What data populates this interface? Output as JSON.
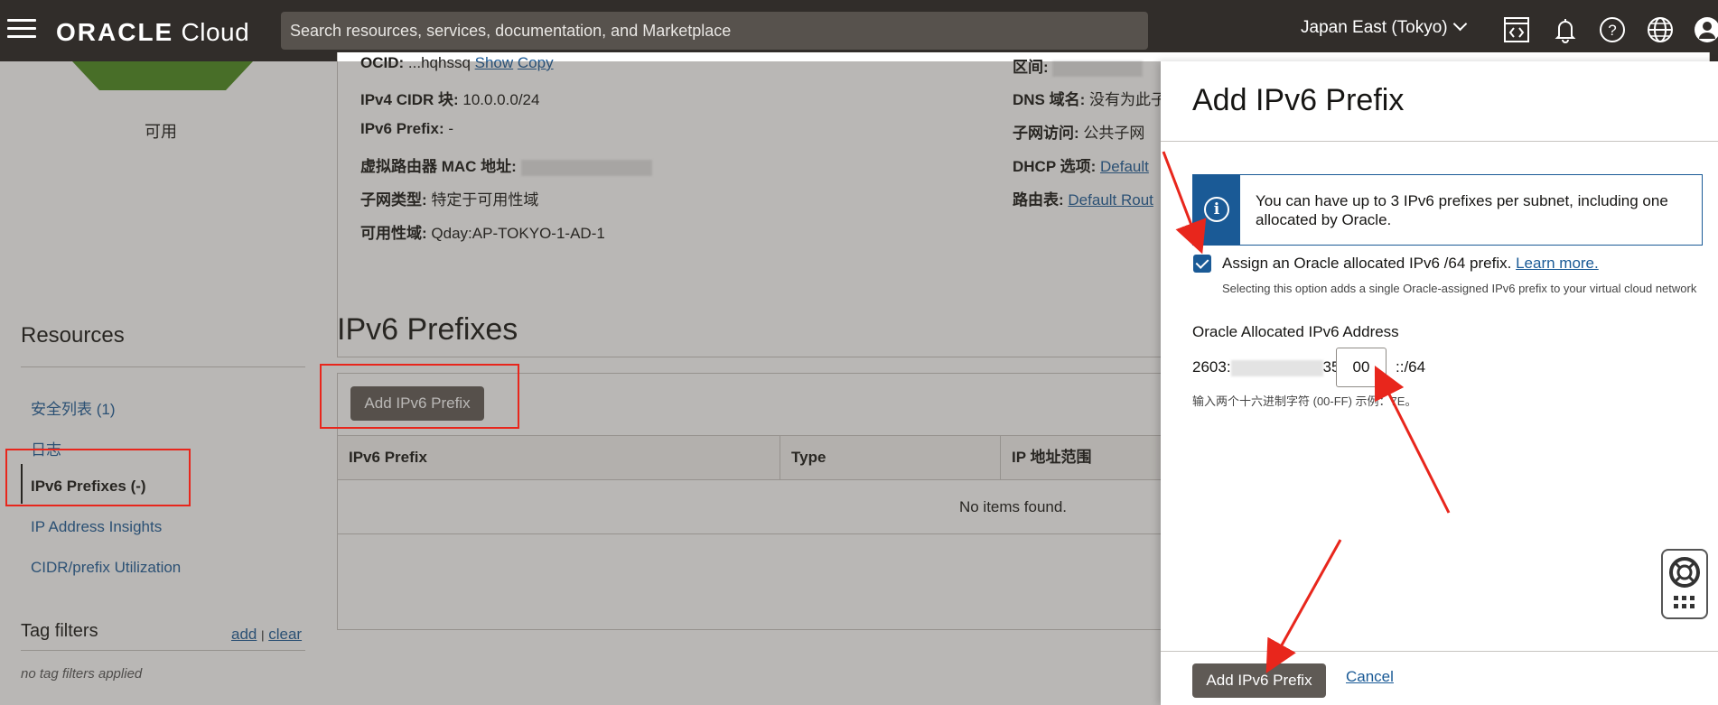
{
  "topbar": {
    "logo_oracle": "ORACLE",
    "logo_cloud": "Cloud",
    "search_placeholder": "Search resources, services, documentation, and Marketplace",
    "region": "Japan East (Tokyo)",
    "icons": [
      "code-editor-icon",
      "bell-icon",
      "help-icon",
      "globe-icon",
      "user-icon"
    ]
  },
  "subnet": {
    "status": "可用",
    "details_left": [
      {
        "label": "OCID:",
        "value": "...hqhssq",
        "links": [
          "Show",
          "Copy"
        ]
      },
      {
        "label": "IPv4 CIDR 块:",
        "value": "10.0.0.0/24"
      },
      {
        "label": "IPv6 Prefix:",
        "value": "-"
      },
      {
        "label": "虚拟路由器 MAC 地址:",
        "value": ""
      },
      {
        "label": "子网类型:",
        "value": "特定于可用性域"
      },
      {
        "label": "可用性域:",
        "value": "Qday:AP-TOKYO-1-AD-1"
      }
    ],
    "details_right": [
      {
        "label": "区间:",
        "value": ""
      },
      {
        "label": "DNS 域名:",
        "value": "没有为此子"
      },
      {
        "label": "子网访问:",
        "value": "公共子网"
      },
      {
        "label": "DHCP 选项:",
        "value": "Default"
      },
      {
        "label": "路由表:",
        "value": "Default Rout"
      }
    ]
  },
  "resources": {
    "title": "Resources",
    "items": [
      {
        "label": "安全列表 (1)"
      },
      {
        "label": "日志"
      },
      {
        "label": "IPv6 Prefixes (-)",
        "active": true
      },
      {
        "label": "IP Address Insights"
      },
      {
        "label": "CIDR/prefix Utilization"
      }
    ]
  },
  "tag_filters": {
    "title": "Tag filters",
    "add": "add",
    "separator": "|",
    "clear": "clear",
    "empty": "no tag filters applied"
  },
  "prefix_section": {
    "title": "IPv6 Prefixes",
    "add_button": "Add IPv6 Prefix",
    "columns": [
      "IPv6 Prefix",
      "Type",
      "IP 地址范围"
    ],
    "empty": "No items found."
  },
  "panel": {
    "title": "Add IPv6 Prefix",
    "info_icon": "i",
    "info": "You can have up to 3 IPv6 prefixes per subnet, including one allocated by Oracle.",
    "checkbox_label": "Assign an Oracle allocated IPv6 /64 prefix.",
    "learn_more": "Learn more.",
    "checkbox_hint": "Selecting this option adds a single Oracle-assigned IPv6 prefix to your virtual cloud network",
    "address_label": "Oracle Allocated IPv6 Address",
    "address_prefix_start": "2603:",
    "address_prefix_end": "35",
    "address_value": "00",
    "address_suffix": "::/64",
    "address_hint": "输入两个十六进制字符 (00-FF) 示例：7E。",
    "submit": "Add IPv6 Prefix",
    "cancel": "Cancel"
  },
  "colors": {
    "topbar": "#312d2a",
    "link": "#1a5a96",
    "button": "#5f5a55",
    "annotation": "#e8261c",
    "status_green": "#4a8a1c"
  }
}
